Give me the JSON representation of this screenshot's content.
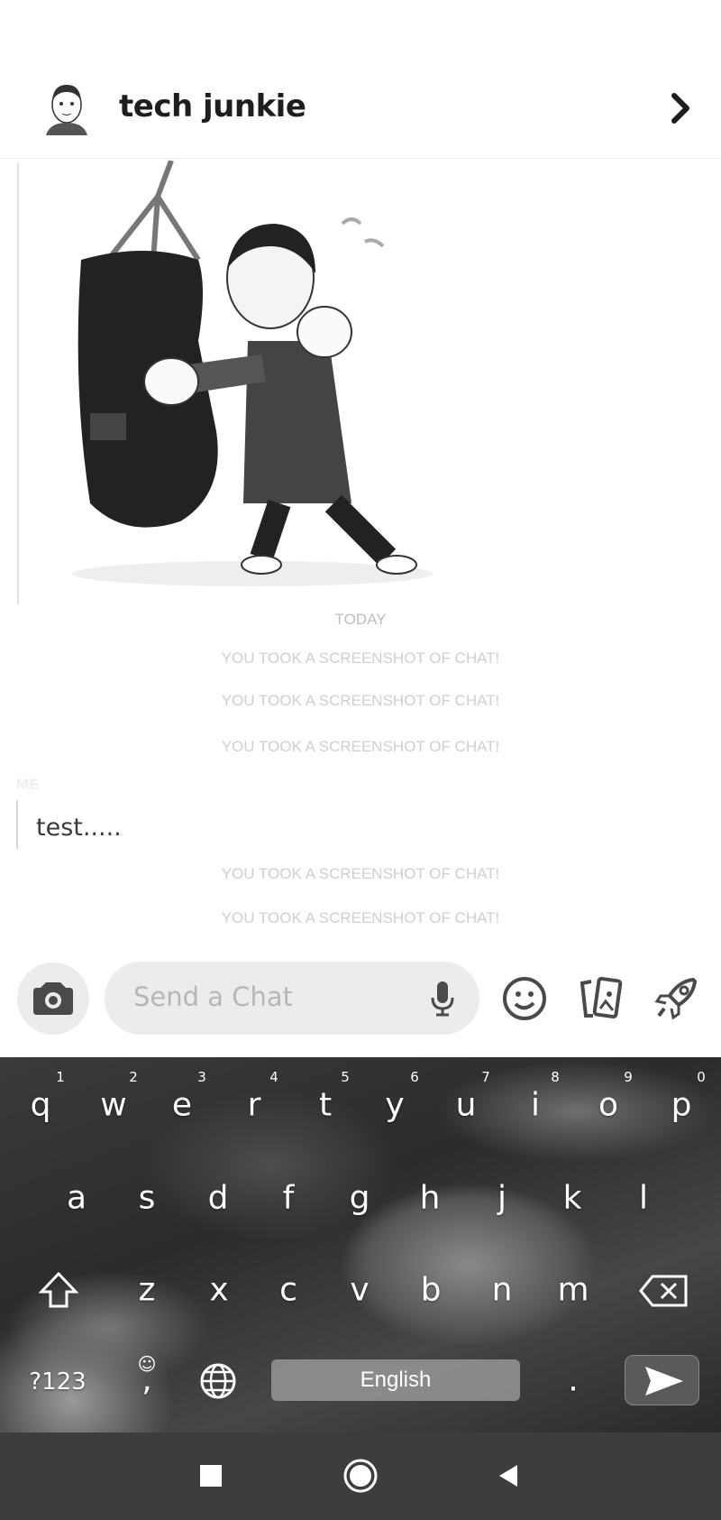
{
  "header": {
    "contact_name": "tech junkie",
    "avatar_icon": "bitmoji-avatar",
    "next_icon": "chevron-right-icon"
  },
  "chat": {
    "sticker": "bitmoji-punching-bag-sticker",
    "date_label": "TODAY",
    "notices_top": [
      "YOU TOOK A SCREENSHOT OF CHAT!",
      "YOU TOOK A SCREENSHOT OF CHAT!",
      "YOU TOOK A SCREENSHOT OF CHAT!"
    ],
    "sender_label": "ME",
    "message": "test.....",
    "notices_bottom": [
      "YOU TOOK A SCREENSHOT OF CHAT!",
      "YOU TOOK A SCREENSHOT OF CHAT!"
    ]
  },
  "composer": {
    "placeholder": "Send a Chat",
    "icons": [
      "camera-icon",
      "microphone-icon",
      "emoji-icon",
      "cards-icon",
      "rocket-icon"
    ]
  },
  "keyboard": {
    "row1": [
      "q",
      "w",
      "e",
      "r",
      "t",
      "y",
      "u",
      "i",
      "o",
      "p"
    ],
    "row1_hints": [
      "1",
      "2",
      "3",
      "4",
      "5",
      "6",
      "7",
      "8",
      "9",
      "0"
    ],
    "row2": [
      "a",
      "s",
      "d",
      "f",
      "g",
      "h",
      "j",
      "k",
      "l"
    ],
    "row3": [
      "z",
      "x",
      "c",
      "v",
      "b",
      "n",
      "m"
    ],
    "symbols_key": "?123",
    "comma_key": ",",
    "comma_hint": "☺",
    "space_label": "English",
    "period_key": "."
  },
  "navbar": {
    "icons": [
      "recents-icon",
      "home-icon",
      "back-icon"
    ]
  }
}
